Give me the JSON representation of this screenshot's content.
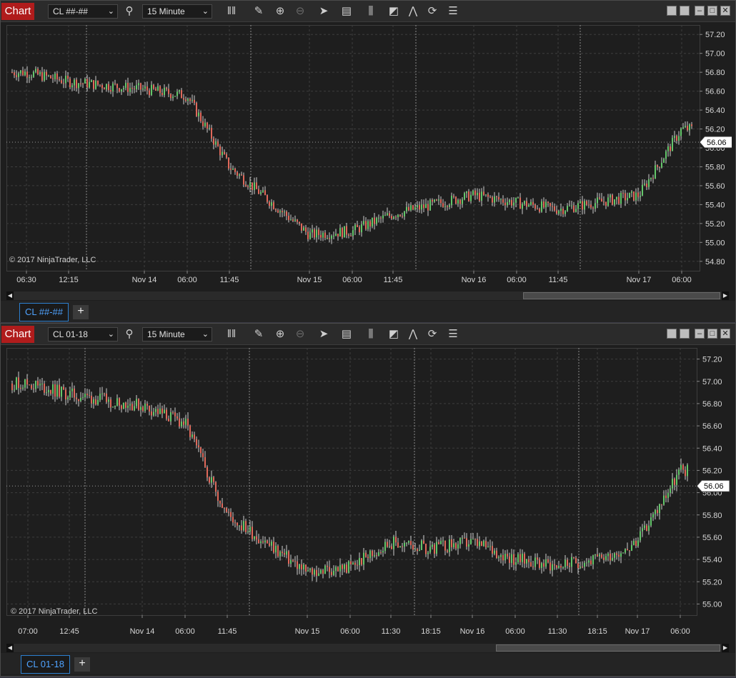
{
  "windows": [
    {
      "title_button": "Chart",
      "instrument": "CL ##-##",
      "interval": "15 Minute",
      "tab_label": "CL ##-##",
      "copyright": "© 2017 NinjaTrader, LLC",
      "current_price": "56.06",
      "x_labels": [
        "06:30",
        "12:15",
        "Nov 14",
        "06:00",
        "11:45",
        "Nov 15",
        "06:00",
        "11:45",
        "Nov 16",
        "06:00",
        "11:45",
        "Nov 17",
        "06:00"
      ],
      "y_labels": [
        "57.20",
        "57.00",
        "56.80",
        "56.60",
        "56.40",
        "56.20",
        "56.00",
        "55.80",
        "55.60",
        "55.40",
        "55.20",
        "55.00",
        "54.80"
      ]
    },
    {
      "title_button": "Chart",
      "instrument": "CL 01-18",
      "interval": "15 Minute",
      "tab_label": "CL 01-18",
      "copyright": "© 2017 NinjaTrader, LLC",
      "current_price": "56.06",
      "x_labels": [
        "07:00",
        "12:45",
        "Nov 14",
        "06:00",
        "11:45",
        "Nov 15",
        "06:00",
        "11:30",
        "18:15",
        "Nov 16",
        "06:00",
        "11:30",
        "18:15",
        "Nov 17",
        "06:00"
      ],
      "y_labels": [
        "57.20",
        "57.00",
        "56.80",
        "56.60",
        "56.40",
        "56.20",
        "56.00",
        "55.80",
        "55.60",
        "55.40",
        "55.20",
        "55.00"
      ]
    }
  ],
  "toolbar_icons": [
    "bar-type-icon",
    "pencil-icon",
    "zoom-in-icon",
    "zoom-out-icon",
    "pointer-icon",
    "data-box-icon",
    "bar-width-icon",
    "templates-icon",
    "strategies-icon",
    "refresh-icon",
    "properties-icon"
  ],
  "chart_data": [
    {
      "type": "candlestick",
      "title": "CL ##-##",
      "interval": "15 Minute",
      "x": [
        "06:30",
        "12:15",
        "Nov 14",
        "06:00",
        "11:45",
        "Nov 15",
        "06:00",
        "11:45",
        "Nov 16",
        "06:00",
        "11:45",
        "Nov 17",
        "06:00"
      ],
      "close": [
        56.8,
        56.7,
        56.62,
        56.55,
        55.8,
        55.08,
        55.12,
        55.3,
        55.5,
        55.42,
        55.35,
        55.5,
        56.2
      ],
      "last": 56.06,
      "ylim": [
        54.7,
        57.3
      ],
      "grid": true,
      "colors": {
        "up": "#63c76a",
        "down": "#e0685a",
        "background": "#1e1e1e",
        "grid": "#3d3d3d"
      }
    },
    {
      "type": "candlestick",
      "title": "CL 01-18",
      "interval": "15 Minute",
      "x": [
        "07:00",
        "12:45",
        "Nov 14",
        "06:00",
        "11:45",
        "Nov 15",
        "06:00",
        "11:30",
        "18:15",
        "Nov 16",
        "06:00",
        "11:30",
        "18:15",
        "Nov 17",
        "06:00"
      ],
      "close": [
        56.98,
        56.88,
        56.78,
        56.62,
        55.8,
        55.28,
        55.33,
        55.55,
        55.5,
        55.55,
        55.4,
        55.35,
        55.4,
        55.55,
        56.2
      ],
      "last": 56.06,
      "ylim": [
        54.9,
        57.3
      ],
      "grid": true,
      "colors": {
        "up": "#63c76a",
        "down": "#e0685a",
        "background": "#1e1e1e",
        "grid": "#3d3d3d"
      }
    }
  ]
}
